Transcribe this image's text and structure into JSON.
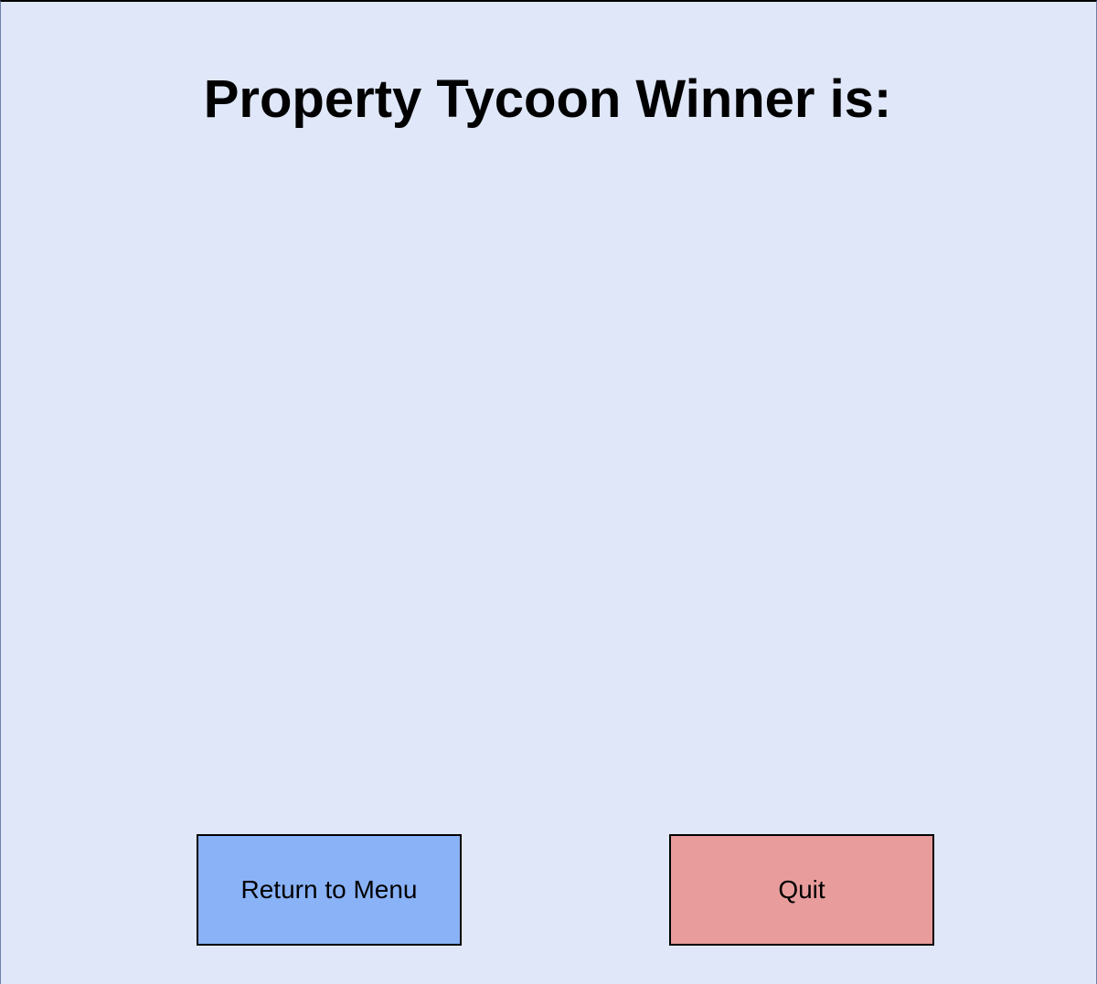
{
  "title": "Property Tycoon Winner is:",
  "buttons": {
    "return_to_menu": "Return to Menu",
    "quit": "Quit"
  },
  "colors": {
    "background": "#dfe7f9",
    "menu_button": "#89b2f7",
    "quit_button": "#e89d9c",
    "border": "#000000"
  }
}
